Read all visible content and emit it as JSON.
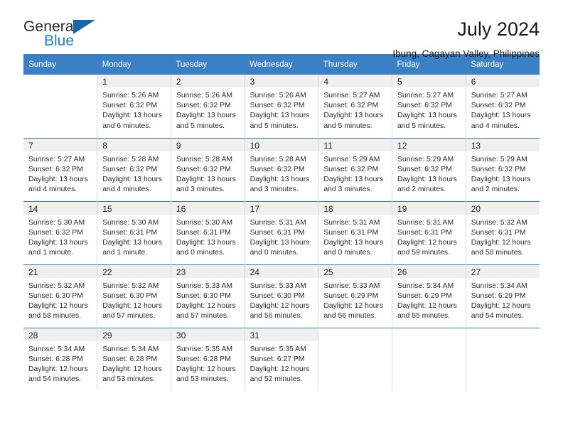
{
  "brand": {
    "name_top": "General",
    "name_bottom": "Blue",
    "accent_color": "#1b7fc4",
    "triangle_color": "#1567ab"
  },
  "header": {
    "title": "July 2024",
    "subtitle": "Ibung, Cagayan Valley, Philippines"
  },
  "calendar": {
    "header_bg": "#3b7fc4",
    "header_text_color": "#ffffff",
    "daynum_bg": "#f0f0f0",
    "weekdays": [
      "Sunday",
      "Monday",
      "Tuesday",
      "Wednesday",
      "Thursday",
      "Friday",
      "Saturday"
    ],
    "weeks": [
      [
        {
          "day": "",
          "lines": []
        },
        {
          "day": "1",
          "lines": [
            "Sunrise: 5:26 AM",
            "Sunset: 6:32 PM",
            "Daylight: 13 hours",
            "and 6 minutes."
          ]
        },
        {
          "day": "2",
          "lines": [
            "Sunrise: 5:26 AM",
            "Sunset: 6:32 PM",
            "Daylight: 13 hours",
            "and 5 minutes."
          ]
        },
        {
          "day": "3",
          "lines": [
            "Sunrise: 5:26 AM",
            "Sunset: 6:32 PM",
            "Daylight: 13 hours",
            "and 5 minutes."
          ]
        },
        {
          "day": "4",
          "lines": [
            "Sunrise: 5:27 AM",
            "Sunset: 6:32 PM",
            "Daylight: 13 hours",
            "and 5 minutes."
          ]
        },
        {
          "day": "5",
          "lines": [
            "Sunrise: 5:27 AM",
            "Sunset: 6:32 PM",
            "Daylight: 13 hours",
            "and 5 minutes."
          ]
        },
        {
          "day": "6",
          "lines": [
            "Sunrise: 5:27 AM",
            "Sunset: 6:32 PM",
            "Daylight: 13 hours",
            "and 4 minutes."
          ]
        }
      ],
      [
        {
          "day": "7",
          "lines": [
            "Sunrise: 5:27 AM",
            "Sunset: 6:32 PM",
            "Daylight: 13 hours",
            "and 4 minutes."
          ]
        },
        {
          "day": "8",
          "lines": [
            "Sunrise: 5:28 AM",
            "Sunset: 6:32 PM",
            "Daylight: 13 hours",
            "and 4 minutes."
          ]
        },
        {
          "day": "9",
          "lines": [
            "Sunrise: 5:28 AM",
            "Sunset: 6:32 PM",
            "Daylight: 13 hours",
            "and 3 minutes."
          ]
        },
        {
          "day": "10",
          "lines": [
            "Sunrise: 5:28 AM",
            "Sunset: 6:32 PM",
            "Daylight: 13 hours",
            "and 3 minutes."
          ]
        },
        {
          "day": "11",
          "lines": [
            "Sunrise: 5:29 AM",
            "Sunset: 6:32 PM",
            "Daylight: 13 hours",
            "and 3 minutes."
          ]
        },
        {
          "day": "12",
          "lines": [
            "Sunrise: 5:29 AM",
            "Sunset: 6:32 PM",
            "Daylight: 13 hours",
            "and 2 minutes."
          ]
        },
        {
          "day": "13",
          "lines": [
            "Sunrise: 5:29 AM",
            "Sunset: 6:32 PM",
            "Daylight: 13 hours",
            "and 2 minutes."
          ]
        }
      ],
      [
        {
          "day": "14",
          "lines": [
            "Sunrise: 5:30 AM",
            "Sunset: 6:32 PM",
            "Daylight: 13 hours",
            "and 1 minute."
          ]
        },
        {
          "day": "15",
          "lines": [
            "Sunrise: 5:30 AM",
            "Sunset: 6:31 PM",
            "Daylight: 13 hours",
            "and 1 minute."
          ]
        },
        {
          "day": "16",
          "lines": [
            "Sunrise: 5:30 AM",
            "Sunset: 6:31 PM",
            "Daylight: 13 hours",
            "and 0 minutes."
          ]
        },
        {
          "day": "17",
          "lines": [
            "Sunrise: 5:31 AM",
            "Sunset: 6:31 PM",
            "Daylight: 13 hours",
            "and 0 minutes."
          ]
        },
        {
          "day": "18",
          "lines": [
            "Sunrise: 5:31 AM",
            "Sunset: 6:31 PM",
            "Daylight: 13 hours",
            "and 0 minutes."
          ]
        },
        {
          "day": "19",
          "lines": [
            "Sunrise: 5:31 AM",
            "Sunset: 6:31 PM",
            "Daylight: 12 hours",
            "and 59 minutes."
          ]
        },
        {
          "day": "20",
          "lines": [
            "Sunrise: 5:32 AM",
            "Sunset: 6:31 PM",
            "Daylight: 12 hours",
            "and 58 minutes."
          ]
        }
      ],
      [
        {
          "day": "21",
          "lines": [
            "Sunrise: 5:32 AM",
            "Sunset: 6:30 PM",
            "Daylight: 12 hours",
            "and 58 minutes."
          ]
        },
        {
          "day": "22",
          "lines": [
            "Sunrise: 5:32 AM",
            "Sunset: 6:30 PM",
            "Daylight: 12 hours",
            "and 57 minutes."
          ]
        },
        {
          "day": "23",
          "lines": [
            "Sunrise: 5:33 AM",
            "Sunset: 6:30 PM",
            "Daylight: 12 hours",
            "and 57 minutes."
          ]
        },
        {
          "day": "24",
          "lines": [
            "Sunrise: 5:33 AM",
            "Sunset: 6:30 PM",
            "Daylight: 12 hours",
            "and 56 minutes."
          ]
        },
        {
          "day": "25",
          "lines": [
            "Sunrise: 5:33 AM",
            "Sunset: 6:29 PM",
            "Daylight: 12 hours",
            "and 56 minutes."
          ]
        },
        {
          "day": "26",
          "lines": [
            "Sunrise: 5:34 AM",
            "Sunset: 6:29 PM",
            "Daylight: 12 hours",
            "and 55 minutes."
          ]
        },
        {
          "day": "27",
          "lines": [
            "Sunrise: 5:34 AM",
            "Sunset: 6:29 PM",
            "Daylight: 12 hours",
            "and 54 minutes."
          ]
        }
      ],
      [
        {
          "day": "28",
          "lines": [
            "Sunrise: 5:34 AM",
            "Sunset: 6:28 PM",
            "Daylight: 12 hours",
            "and 54 minutes."
          ]
        },
        {
          "day": "29",
          "lines": [
            "Sunrise: 5:34 AM",
            "Sunset: 6:28 PM",
            "Daylight: 12 hours",
            "and 53 minutes."
          ]
        },
        {
          "day": "30",
          "lines": [
            "Sunrise: 5:35 AM",
            "Sunset: 6:28 PM",
            "Daylight: 12 hours",
            "and 53 minutes."
          ]
        },
        {
          "day": "31",
          "lines": [
            "Sunrise: 5:35 AM",
            "Sunset: 6:27 PM",
            "Daylight: 12 hours",
            "and 52 minutes."
          ]
        },
        {
          "day": "",
          "lines": []
        },
        {
          "day": "",
          "lines": []
        },
        {
          "day": "",
          "lines": []
        }
      ]
    ]
  }
}
